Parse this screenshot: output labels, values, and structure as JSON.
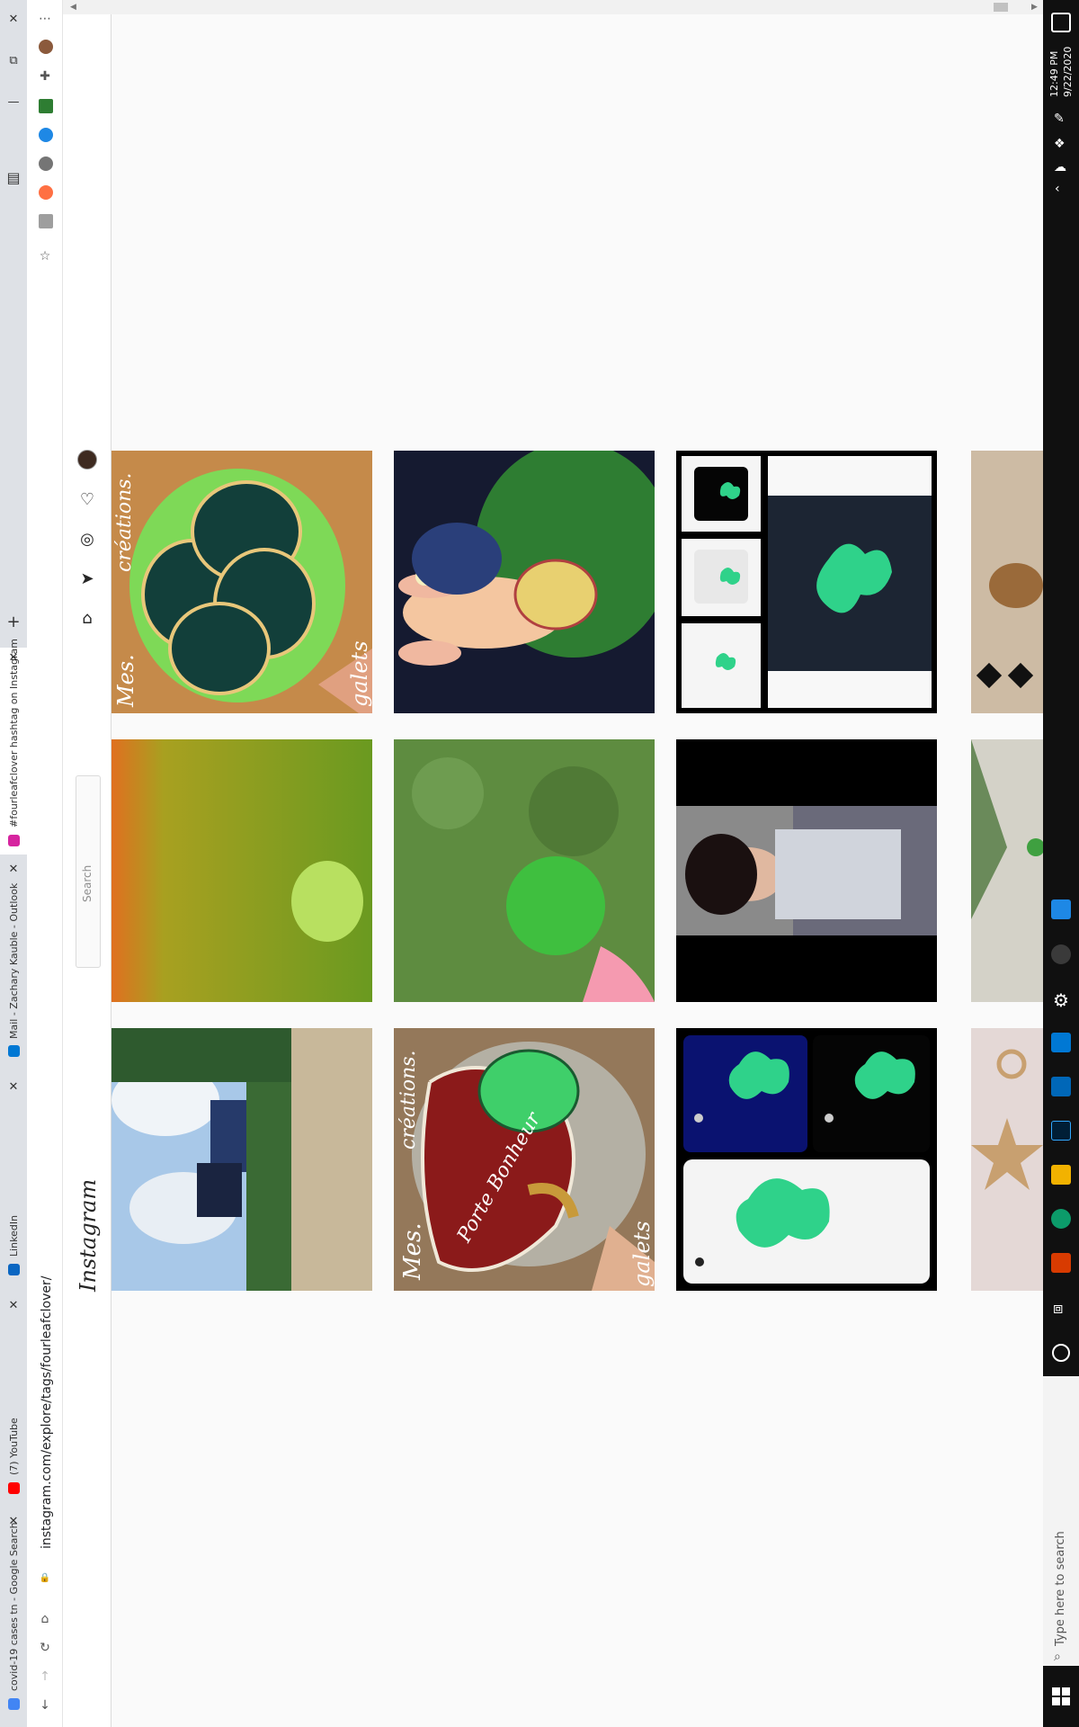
{
  "browser": {
    "url": "instagram.com/explore/tags/fourleafclover/",
    "tabs": [
      {
        "title": "covid-19 cases tn - Google Search",
        "favicon_color": "#4285f4"
      },
      {
        "title": "(7) YouTube",
        "favicon_color": "#ff0000"
      },
      {
        "title": "LinkedIn",
        "favicon_color": "#0a66c2"
      },
      {
        "title": "Mail - Zachary Kauble - Outlook",
        "favicon_color": "#0078d4"
      },
      {
        "title": "#fourleafclover hashtag on Instagram",
        "favicon_color": "#d6249f",
        "active": true
      }
    ]
  },
  "instagram": {
    "logo": "Instagram",
    "search_placeholder": "Search",
    "nav": [
      "home-icon",
      "direct-icon",
      "explore-icon",
      "activity-icon",
      "profile-avatar"
    ]
  },
  "posts": [
    {
      "row": 0,
      "col": 0,
      "desc": "painted stone clover"
    },
    {
      "row": 0,
      "col": 1,
      "desc": "rabbit painting"
    },
    {
      "row": 0,
      "col": 2,
      "desc": "clover merchandise"
    },
    {
      "row": 0,
      "col": 3,
      "desc": "jewelry"
    },
    {
      "row": 1,
      "col": 0,
      "desc": "sunset field"
    },
    {
      "row": 1,
      "col": 1,
      "desc": "four leaf clover in grass"
    },
    {
      "row": 1,
      "col": 2,
      "desc": "video woman"
    },
    {
      "row": 1,
      "col": 3,
      "desc": "clover plant"
    },
    {
      "row": 2,
      "col": 0,
      "desc": "hikers"
    },
    {
      "row": 2,
      "col": 1,
      "desc": "painted heart stone"
    },
    {
      "row": 2,
      "col": 2,
      "desc": "clover phone cases"
    },
    {
      "row": 2,
      "col": 3,
      "desc": "gold star charm"
    }
  ],
  "post_texts": {
    "stone_top": "Mes.",
    "stone_bottom": "galets",
    "stone_side": "créations.",
    "heart_text": "Porte Bonheur"
  },
  "taskbar": {
    "time": "12:49 PM",
    "date": "9/22/2020",
    "search_placeholder": "Type here to search"
  },
  "colors": {
    "ig_border": "#dbdbdb",
    "taskbar": "#101010",
    "tab_bg": "#dee1e6"
  }
}
